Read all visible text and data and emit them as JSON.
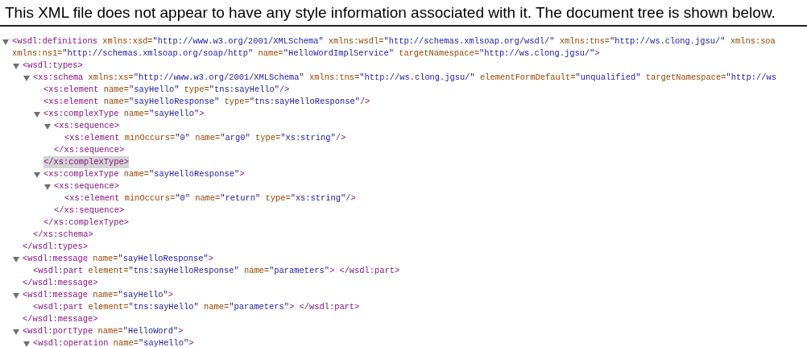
{
  "header": {
    "notice": "This XML file does not appear to have any style information associated with it. The document tree is shown below."
  },
  "tree": [
    {
      "kind": "branch",
      "expanded": true,
      "tokens": [
        {
          "kind": "tag",
          "text": "<wsdl:definitions"
        },
        {
          "kind": "attr",
          "text": " xmlns:xsd="
        },
        {
          "kind": "value",
          "text": "\"http://www.w3.org/2001/XMLSchema\""
        },
        {
          "kind": "attr",
          "text": " xmlns:wsdl="
        },
        {
          "kind": "value",
          "text": "\"http://schemas.xmlsoap.org/wsdl/\""
        },
        {
          "kind": "attr",
          "text": " xmlns:tns="
        },
        {
          "kind": "value",
          "text": "\"http://ws.clong.jgsu/\""
        },
        {
          "kind": "attr",
          "text": " xmlns:soa"
        }
      ],
      "continuation": {
        "tokens": [
          {
            "kind": "attr",
            "text": "xmlns:ns1="
          },
          {
            "kind": "value",
            "text": "\"http://schemas.xmlsoap.org/soap/http\""
          },
          {
            "kind": "attr",
            "text": " name="
          },
          {
            "kind": "value",
            "text": "\"HelloWordImplService\""
          },
          {
            "kind": "attr",
            "text": " targetNamespace="
          },
          {
            "kind": "value",
            "text": "\"http://ws.clong.jgsu/\""
          },
          {
            "kind": "tag",
            "text": ">"
          }
        ]
      },
      "children": [
        {
          "kind": "branch",
          "expanded": true,
          "tokens": [
            {
              "kind": "tag",
              "text": "<wsdl:types>"
            }
          ],
          "children": [
            {
              "kind": "branch",
              "expanded": true,
              "tokens": [
                {
                  "kind": "tag",
                  "text": "<xs:schema"
                },
                {
                  "kind": "attr",
                  "text": " xmlns:xs="
                },
                {
                  "kind": "value",
                  "text": "\"http://www.w3.org/2001/XMLSchema\""
                },
                {
                  "kind": "attr",
                  "text": " xmlns:tns="
                },
                {
                  "kind": "value",
                  "text": "\"http://ws.clong.jgsu/\""
                },
                {
                  "kind": "attr",
                  "text": " elementFormDefault="
                },
                {
                  "kind": "value",
                  "text": "\"unqualified\""
                },
                {
                  "kind": "attr",
                  "text": " targetNamespace="
                },
                {
                  "kind": "value",
                  "text": "\"http://ws"
                }
              ],
              "children": [
                {
                  "kind": "leaf",
                  "tokens": [
                    {
                      "kind": "tag",
                      "text": "<xs:element"
                    },
                    {
                      "kind": "attr",
                      "text": " name="
                    },
                    {
                      "kind": "value",
                      "text": "\"sayHello\""
                    },
                    {
                      "kind": "attr",
                      "text": " type="
                    },
                    {
                      "kind": "value",
                      "text": "\"tns:sayHello\""
                    },
                    {
                      "kind": "tag",
                      "text": "/>"
                    }
                  ]
                },
                {
                  "kind": "leaf",
                  "tokens": [
                    {
                      "kind": "tag",
                      "text": "<xs:element"
                    },
                    {
                      "kind": "attr",
                      "text": " name="
                    },
                    {
                      "kind": "value",
                      "text": "\"sayHelloResponse\""
                    },
                    {
                      "kind": "attr",
                      "text": " type="
                    },
                    {
                      "kind": "value",
                      "text": "\"tns:sayHelloResponse\""
                    },
                    {
                      "kind": "tag",
                      "text": "/>"
                    }
                  ]
                },
                {
                  "kind": "branch",
                  "expanded": true,
                  "tokens": [
                    {
                      "kind": "tag",
                      "text": "<xs:complexType"
                    },
                    {
                      "kind": "attr",
                      "text": " name="
                    },
                    {
                      "kind": "value",
                      "text": "\"sayHello\""
                    },
                    {
                      "kind": "tag",
                      "text": ">"
                    }
                  ],
                  "children": [
                    {
                      "kind": "branch",
                      "expanded": true,
                      "tokens": [
                        {
                          "kind": "tag",
                          "text": "<xs:sequence>"
                        }
                      ],
                      "children": [
                        {
                          "kind": "leaf",
                          "tokens": [
                            {
                              "kind": "tag",
                              "text": "<xs:element"
                            },
                            {
                              "kind": "attr",
                              "text": " minOccurs="
                            },
                            {
                              "kind": "value",
                              "text": "\"0\""
                            },
                            {
                              "kind": "attr",
                              "text": " name="
                            },
                            {
                              "kind": "value",
                              "text": "\"arg0\""
                            },
                            {
                              "kind": "attr",
                              "text": " type="
                            },
                            {
                              "kind": "value",
                              "text": "\"xs:string\""
                            },
                            {
                              "kind": "tag",
                              "text": "/>"
                            }
                          ]
                        }
                      ],
                      "close": {
                        "text": "</xs:sequence>",
                        "selected": false
                      }
                    }
                  ],
                  "close": {
                    "text": "</xs:complexType>",
                    "selected": true
                  }
                },
                {
                  "kind": "branch",
                  "expanded": true,
                  "tokens": [
                    {
                      "kind": "tag",
                      "text": "<xs:complexType"
                    },
                    {
                      "kind": "attr",
                      "text": " name="
                    },
                    {
                      "kind": "value",
                      "text": "\"sayHelloResponse\""
                    },
                    {
                      "kind": "tag",
                      "text": ">"
                    }
                  ],
                  "children": [
                    {
                      "kind": "branch",
                      "expanded": true,
                      "tokens": [
                        {
                          "kind": "tag",
                          "text": "<xs:sequence>"
                        }
                      ],
                      "children": [
                        {
                          "kind": "leaf",
                          "tokens": [
                            {
                              "kind": "tag",
                              "text": "<xs:element"
                            },
                            {
                              "kind": "attr",
                              "text": " minOccurs="
                            },
                            {
                              "kind": "value",
                              "text": "\"0\""
                            },
                            {
                              "kind": "attr",
                              "text": " name="
                            },
                            {
                              "kind": "value",
                              "text": "\"return\""
                            },
                            {
                              "kind": "attr",
                              "text": " type="
                            },
                            {
                              "kind": "value",
                              "text": "\"xs:string\""
                            },
                            {
                              "kind": "tag",
                              "text": "/>"
                            }
                          ]
                        }
                      ],
                      "close": {
                        "text": "</xs:sequence>",
                        "selected": false
                      }
                    }
                  ],
                  "close": {
                    "text": "</xs:complexType>",
                    "selected": false
                  }
                }
              ],
              "close": {
                "text": "</xs:schema>",
                "selected": false
              }
            }
          ],
          "close": {
            "text": "</wsdl:types>",
            "selected": false
          }
        },
        {
          "kind": "branch",
          "expanded": true,
          "tokens": [
            {
              "kind": "tag",
              "text": "<wsdl:message"
            },
            {
              "kind": "attr",
              "text": " name="
            },
            {
              "kind": "value",
              "text": "\"sayHelloResponse\""
            },
            {
              "kind": "tag",
              "text": ">"
            }
          ],
          "children": [
            {
              "kind": "leaf",
              "tokens": [
                {
                  "kind": "tag",
                  "text": "<wsdl:part"
                },
                {
                  "kind": "attr",
                  "text": " element="
                },
                {
                  "kind": "value",
                  "text": "\"tns:sayHelloResponse\""
                },
                {
                  "kind": "attr",
                  "text": " name="
                },
                {
                  "kind": "value",
                  "text": "\"parameters\""
                },
                {
                  "kind": "tag",
                  "text": "> </wsdl:part>"
                }
              ]
            }
          ],
          "close": {
            "text": "</wsdl:message>",
            "selected": false
          }
        },
        {
          "kind": "branch",
          "expanded": true,
          "tokens": [
            {
              "kind": "tag",
              "text": "<wsdl:message"
            },
            {
              "kind": "attr",
              "text": " name="
            },
            {
              "kind": "value",
              "text": "\"sayHello\""
            },
            {
              "kind": "tag",
              "text": ">"
            }
          ],
          "children": [
            {
              "kind": "leaf",
              "tokens": [
                {
                  "kind": "tag",
                  "text": "<wsdl:part"
                },
                {
                  "kind": "attr",
                  "text": " element="
                },
                {
                  "kind": "value",
                  "text": "\"tns:sayHello\""
                },
                {
                  "kind": "attr",
                  "text": " name="
                },
                {
                  "kind": "value",
                  "text": "\"parameters\""
                },
                {
                  "kind": "tag",
                  "text": "> </wsdl:part>"
                }
              ]
            }
          ],
          "close": {
            "text": "</wsdl:message>",
            "selected": false
          }
        },
        {
          "kind": "branch",
          "expanded": true,
          "tokens": [
            {
              "kind": "tag",
              "text": "<wsdl:portType"
            },
            {
              "kind": "attr",
              "text": " name="
            },
            {
              "kind": "value",
              "text": "\"HelloWord\""
            },
            {
              "kind": "tag",
              "text": ">"
            }
          ],
          "children": [
            {
              "kind": "branch",
              "expanded": true,
              "tokens": [
                {
                  "kind": "tag",
                  "text": "<wsdl:operation"
                },
                {
                  "kind": "attr",
                  "text": " name="
                },
                {
                  "kind": "value",
                  "text": "\"sayHello\""
                },
                {
                  "kind": "tag",
                  "text": ">"
                }
              ]
            }
          ]
        }
      ]
    }
  ]
}
